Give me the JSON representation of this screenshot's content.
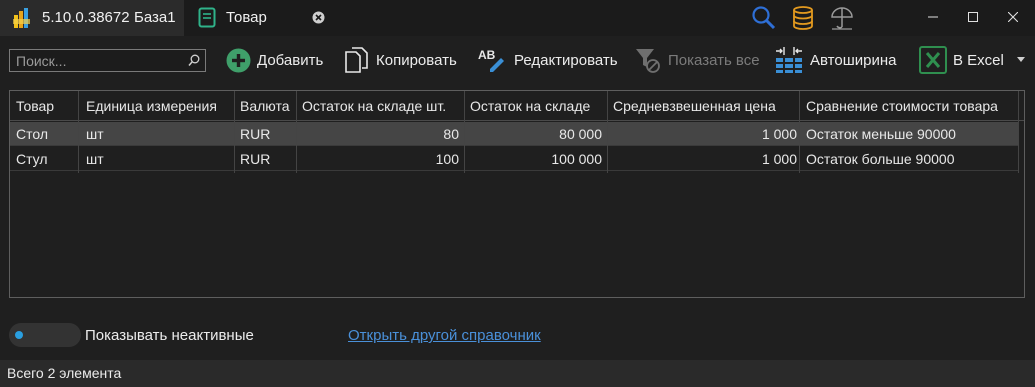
{
  "titlebar": {
    "app_version": "5.10.0.38672",
    "database_name": "База1",
    "document_tab_title": "Товар",
    "icons": [
      "search-icon",
      "database-icon",
      "umbrella-icon"
    ],
    "window_controls": {
      "minimize": "–",
      "maximize": "□",
      "close": "✕"
    }
  },
  "toolbar": {
    "search_placeholder": "Поиск...",
    "search_value": "",
    "add_label": "Добавить",
    "copy_label": "Копировать",
    "edit_label": "Редактировать",
    "show_all_label": "Показать все",
    "autowidth_label": "Автоширина",
    "excel_label": "В Excel"
  },
  "table": {
    "columns": [
      "Товар",
      "Единица измерения",
      "Валюта",
      "Остаток на складе шт.",
      "Остаток на складе",
      "Средневзвешенная цена",
      "Сравнение стоимости товара"
    ],
    "rows": [
      [
        "Стол",
        "шт",
        "RUR",
        "80",
        "80 000",
        "1 000",
        "Остаток меньше 90000"
      ],
      [
        "Стул",
        "шт",
        "RUR",
        "100",
        "100 000",
        "1 000",
        "Остаток больше 90000"
      ]
    ],
    "selected_row": 0
  },
  "bottom": {
    "toggle_label": "Показывать неактивные",
    "toggle_on": false,
    "link_label": "Открыть другой справочник"
  },
  "status": {
    "text": "Всего 2 элемента"
  },
  "colors": {
    "accent": "#2a9fe0",
    "add_icon": "#3f9f6a",
    "excel_green": "#2f8f4f",
    "search_blue": "#2e6fd6",
    "database_orange": "#e39a1f",
    "link": "#4a90d9"
  }
}
